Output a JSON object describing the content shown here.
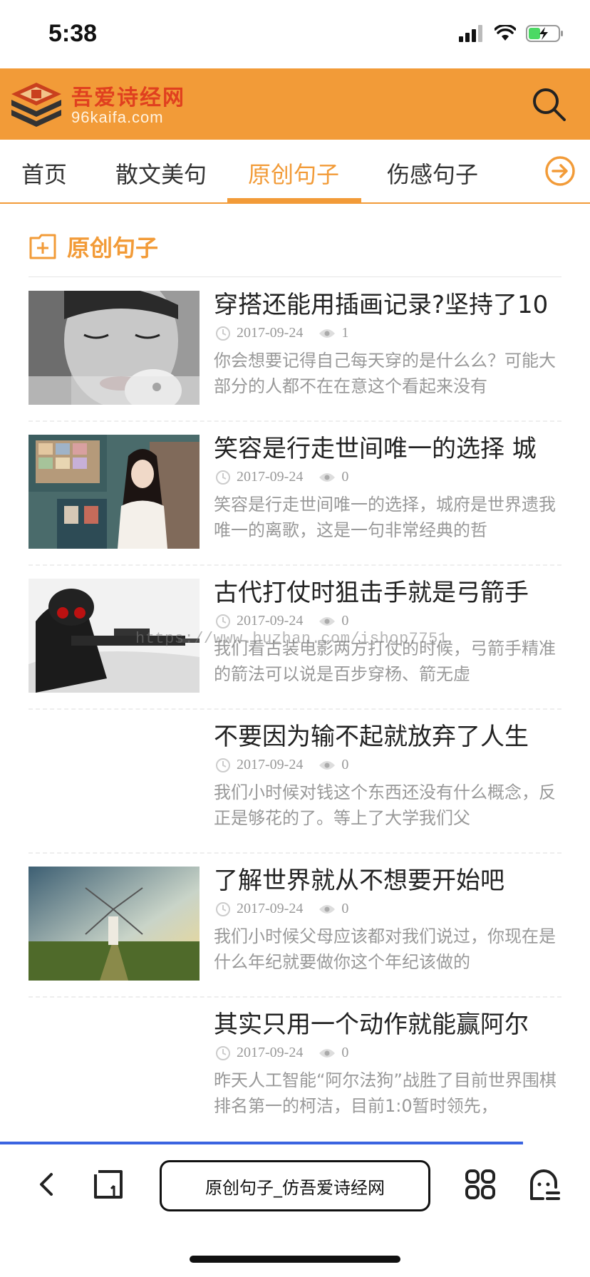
{
  "status": {
    "time": "5:38"
  },
  "header": {
    "logo_text": "吾爱诗经网",
    "logo_sub": "96kaifa.com",
    "search_icon": "search-icon"
  },
  "nav": {
    "items": [
      {
        "label": "首页"
      },
      {
        "label": "散文美句"
      },
      {
        "label": "原创句子",
        "active": true
      },
      {
        "label": "伤感句子"
      },
      {
        "label": "["
      }
    ],
    "more_icon": "arrow-right-circle-icon"
  },
  "section": {
    "title": "原创句子"
  },
  "articles": [
    {
      "title": "穿搭还能用插画记录?坚持了10",
      "date": "2017-09-24",
      "views": "1",
      "desc": "你会想要记得自己每天穿的是什么么？可能大部分的人都不在在意这个看起来没有",
      "thumb": "portrait-bw"
    },
    {
      "title": "笑容是行走世间唯一的选择 城",
      "date": "2017-09-24",
      "views": "0",
      "desc": "笑容是行走世间唯一的选择，城府是世界遗我唯一的离歌，这是一句非常经典的哲",
      "thumb": "girl-room"
    },
    {
      "title": "古代打仗时狙击手就是弓箭手",
      "date": "2017-09-24",
      "views": "0",
      "desc": "我们看古装电影两方打仗的时候，弓箭手精准的箭法可以说是百步穿杨、箭无虚",
      "thumb": "sniper"
    },
    {
      "title": "不要因为输不起就放弃了人生",
      "date": "2017-09-24",
      "views": "0",
      "desc": "我们小时候对钱这个东西还没有什么概念，反正是够花的了。等上了大学我们父",
      "thumb": ""
    },
    {
      "title": "了解世界就从不想要开始吧",
      "date": "2017-09-24",
      "views": "0",
      "desc": "我们小时候父母应该都对我们说过，你现在是什么年纪就要做你这个年纪该做的",
      "thumb": "windmill"
    },
    {
      "title": "其实只用一个动作就能赢阿尔",
      "date": "2017-09-24",
      "views": "0",
      "desc": "昨天人工智能“阿尔法狗”战胜了目前世界围棋排名第一的柯洁，目前1:0暂时领先，",
      "thumb": ""
    }
  ],
  "watermark": "https://www.huzhan.com/ishop7751",
  "browser": {
    "url_title": "原创句子_仿吾爱诗经网",
    "load_progress": 0.886
  },
  "colors": {
    "accent": "#f29b38",
    "progress": "#3b64e0"
  }
}
